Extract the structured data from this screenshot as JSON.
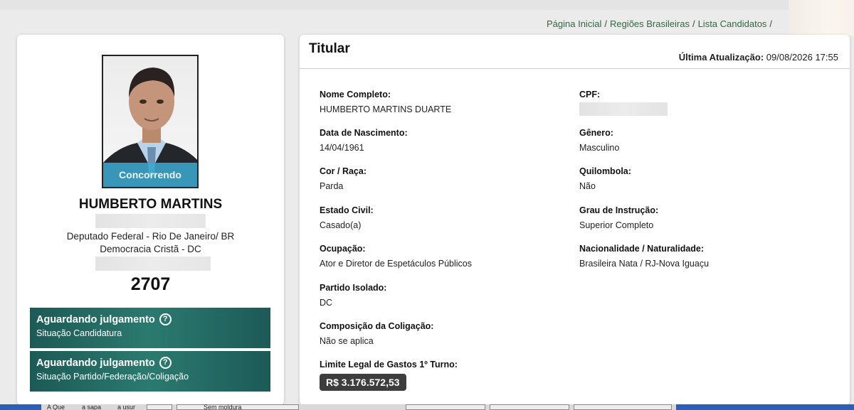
{
  "breadcrumb": [
    {
      "label": "Página Inicial"
    },
    {
      "label": "Regiões Brasileiras"
    },
    {
      "label": "Lista Candidatos"
    }
  ],
  "breadcrumb_separator": "/",
  "candidate": {
    "photo_status": "Concorrendo",
    "name": "HUMBERTO MARTINS",
    "office": "Deputado Federal - Rio De Janeiro/ BR",
    "party": "Democracia Cristã - DC",
    "number": "2707"
  },
  "status_cards": [
    {
      "title": "Aguardando julgamento",
      "help": "?",
      "subtitle": "Situação Candidatura"
    },
    {
      "title": "Aguardando julgamento",
      "help": "?",
      "subtitle": "Situação Partido/Federação/Coligação"
    }
  ],
  "details": {
    "section_title": "Titular",
    "updated_label": "Última Atualização:",
    "updated_value": "09/08/2026 17:55",
    "fields": {
      "nome_completo": {
        "label": "Nome Completo:",
        "value": "HUMBERTO MARTINS DUARTE"
      },
      "cpf": {
        "label": "CPF:"
      },
      "data_nascimento": {
        "label": "Data de Nascimento:",
        "value": "14/04/1961"
      },
      "genero": {
        "label": "Gênero:",
        "value": "Masculino"
      },
      "cor_raca": {
        "label": "Cor / Raça:",
        "value": "Parda"
      },
      "quilombola": {
        "label": "Quilombola:",
        "value": "Não"
      },
      "estado_civil": {
        "label": "Estado Civil:",
        "value": "Casado(a)"
      },
      "grau_instrucao": {
        "label": "Grau de Instrução:",
        "value": "Superior Completo"
      },
      "ocupacao": {
        "label": "Ocupação:",
        "value": "Ator e Diretor de Espetáculos Públicos"
      },
      "nacionalidade": {
        "label": "Nacionalidade / Naturalidade:",
        "value": "Brasileira Nata / RJ-Nova Iguaçu"
      },
      "partido_isolado": {
        "label": "Partido Isolado:",
        "value": "DC"
      },
      "composicao_coligacao": {
        "label": "Composição da Coligação:",
        "value": "Não se aplica"
      },
      "limite_gastos": {
        "label": "Limite Legal de Gastos 1º Turno:",
        "value": "R$ 3.176.572,53"
      }
    }
  },
  "taskbar": {
    "items": [
      "A Que",
      "a sapa",
      "a usur",
      "Sem moldura"
    ]
  },
  "colors": {
    "breadcrumb_link": "#2e6b3c",
    "status_card": "#1c5a56",
    "photo_badge": "#3caad2",
    "money_badge": "#3d3d3d"
  }
}
